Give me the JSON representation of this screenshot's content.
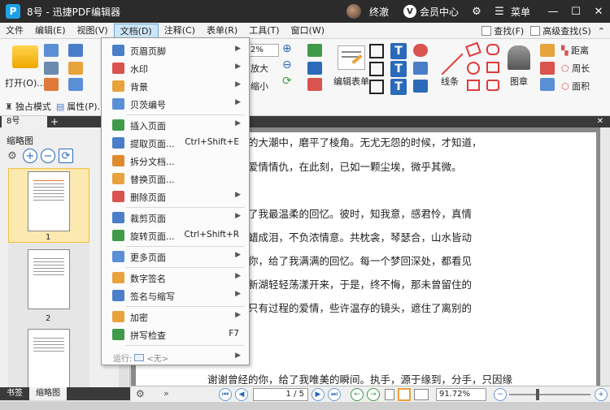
{
  "window": {
    "logo_letter": "P",
    "title": "8号 - 迅捷PDF编辑器",
    "user_name": "终澈",
    "vip_letter": "V",
    "member_center": "会员中心",
    "menu_label": "菜单"
  },
  "menubar": {
    "items": [
      "文件",
      "编辑(E)",
      "视图(V)",
      "文档(D)",
      "注释(C)",
      "表单(R)",
      "工具(T)",
      "窗口(W)"
    ],
    "active_index": 3,
    "find_label": "查找(F)",
    "advanced_find_label": "高级查找(S)"
  },
  "ribbon": {
    "open_label": "打开(O)...",
    "zoom_value": "2%",
    "zoom_in_label": "放大",
    "zoom_out_label": "缩小",
    "edit_form_label": "编辑表单",
    "line_label": "线条",
    "stamp_label": "图章",
    "distance_label": "距离",
    "perimeter_label": "周长",
    "area_label": "面积",
    "exclusive_mode_label": "独占模式",
    "properties_label": "属性(P)..."
  },
  "tabs": {
    "doc_tab": "8号",
    "add": "+",
    "close": "✕"
  },
  "left_panel": {
    "title": "缩略图",
    "page_labels": [
      "1",
      "2"
    ],
    "bottom_tabs": [
      "书签",
      "缩略图"
    ]
  },
  "document": {
    "lines": [
      "我在时间的大潮中，磨平了棱角。无尤无怨的时候，才知道，",
      "，怨着的爱情情仇，在此刻，已如一颗尘埃，微乎其微。",
      "",
      "的你，给了我最温柔的回忆。彼时，知我意，感君怜，真情",
      "时光走，蜡成泪，不负浓情意。共枕衾，琴瑟合，山水皆动",
      "最深爱的你，给了我满满的回忆。每一个梦回深处，都看见",
      "涟漪，在新湖轻轻荡漾开来，于是，终不悔，那未曾留住的",
      "有结果，只有过程的爱情，些许温存的镜头，遮住了离别的",
      "",
      "",
      "谢谢曾经的你，给了我唯美的瞬间。执手，源于缘到，分手，只因缘"
    ]
  },
  "statusbar": {
    "page_display": "1 / 5",
    "zoom": "91.72%"
  },
  "dropdown": {
    "items": [
      {
        "label": "页眉页脚",
        "shortcut": "",
        "submenu": true,
        "color": "#4a7ec8"
      },
      {
        "label": "水印",
        "shortcut": "",
        "submenu": true,
        "color": "#d9534f"
      },
      {
        "label": "背景",
        "shortcut": "",
        "submenu": true,
        "color": "#e8a33d"
      },
      {
        "label": "贝茨编号",
        "shortcut": "",
        "submenu": true,
        "color": "#5a8fd6"
      },
      {
        "label": "插入页面",
        "shortcut": "",
        "submenu": true,
        "color": "#3f9b4a"
      },
      {
        "label": "提取页面...",
        "shortcut": "Ctrl+Shift+E",
        "submenu": false,
        "color": "#4a7ec8"
      },
      {
        "label": "拆分文档...",
        "shortcut": "",
        "submenu": false,
        "color": "#e08a2e"
      },
      {
        "label": "替换页面...",
        "shortcut": "",
        "submenu": false,
        "color": "#e8a33d"
      },
      {
        "label": "删除页面",
        "shortcut": "",
        "submenu": true,
        "color": "#d9534f"
      },
      {
        "label": "裁剪页面",
        "shortcut": "",
        "submenu": true,
        "color": "#4a7ec8"
      },
      {
        "label": "旋转页面...",
        "shortcut": "Ctrl+Shift+R",
        "submenu": false,
        "color": "#3f9b4a"
      },
      {
        "label": "更多页面",
        "shortcut": "",
        "submenu": true,
        "color": "#5a8fd6"
      },
      {
        "label": "数字签名",
        "shortcut": "",
        "submenu": true,
        "color": "#e8a33d"
      },
      {
        "label": "签名与缩写",
        "shortcut": "",
        "submenu": true,
        "color": "#4a7ec8"
      },
      {
        "label": "加密",
        "shortcut": "",
        "submenu": true,
        "color": "#e8a33d"
      },
      {
        "label": "拼写检查",
        "shortcut": "F7",
        "submenu": false,
        "color": "#3f9b4a"
      }
    ],
    "run_label": "运行:",
    "run_value": "<无>"
  }
}
